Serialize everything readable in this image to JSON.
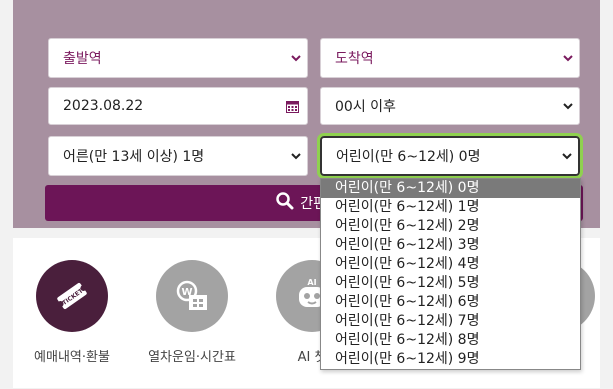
{
  "form": {
    "departure": "출발역",
    "arrival": "도착역",
    "date": "2023.08.22",
    "time": "00시 이후",
    "adult": "어른(만 13세 이상) 1명",
    "child": "어린이(만 6~12세) 0명",
    "search_label": "간편조회"
  },
  "colors": {
    "panel": "#a790a0",
    "accent": "#6c1557",
    "focus_ring": "#8fd14f"
  },
  "quick_menu": [
    {
      "label": "예매내역·환불",
      "icon": "ticket-icon"
    },
    {
      "label": "열차운임·시간표",
      "icon": "fare-timetable-icon"
    },
    {
      "label": "AI 챗",
      "icon": "ai-chat-robot-icon"
    },
    {
      "label": "",
      "icon": "more-icon"
    }
  ],
  "child_options": [
    "어린이(만 6~12세) 0명",
    "어린이(만 6~12세) 1명",
    "어린이(만 6~12세) 2명",
    "어린이(만 6~12세) 3명",
    "어린이(만 6~12세) 4명",
    "어린이(만 6~12세) 5명",
    "어린이(만 6~12세) 6명",
    "어린이(만 6~12세) 7명",
    "어린이(만 6~12세) 8명",
    "어린이(만 6~12세) 9명"
  ],
  "selected_child_index": 0
}
